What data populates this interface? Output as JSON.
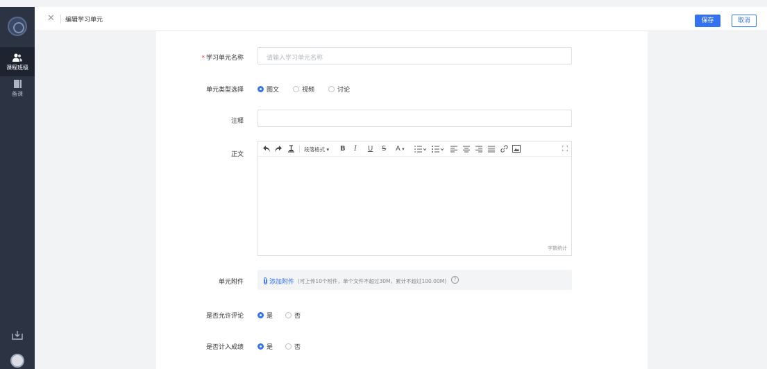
{
  "sidebar": {
    "items": [
      {
        "label": "课程班级",
        "icon": "users-icon"
      },
      {
        "label": "备课",
        "icon": "book-icon"
      }
    ]
  },
  "header": {
    "title": "编辑学习单元",
    "save_label": "保存",
    "cancel_label": "取消"
  },
  "form": {
    "name": {
      "label": "学习单元名称",
      "required_mark": "*",
      "placeholder": "请输入学习单元名称",
      "value": ""
    },
    "type": {
      "label": "单元类型选择",
      "options": [
        "图文",
        "视频",
        "讨论"
      ],
      "selected": "图文"
    },
    "note": {
      "label": "注释",
      "value": ""
    },
    "body": {
      "label": "正文",
      "toolbar": {
        "paragraph_format": "段落格式",
        "bold": "B",
        "italic": "I",
        "underline": "U",
        "strike": "S",
        "font_color": "A"
      },
      "word_count_label": "字数统计"
    },
    "attachment": {
      "label": "单元附件",
      "link_label": "添加附件",
      "hint": "(可上传10个附件，单个文件不超过30M，累计不超过100.00M)"
    },
    "allow_comment": {
      "label": "是否允许评论",
      "options": [
        "是",
        "否"
      ],
      "selected": "是"
    },
    "count_score": {
      "label": "是否计入成绩",
      "options": [
        "是",
        "否"
      ],
      "selected": "是"
    }
  },
  "colors": {
    "primary": "#3472f0",
    "sidebar": "#2c3443",
    "required": "#f5222d"
  }
}
